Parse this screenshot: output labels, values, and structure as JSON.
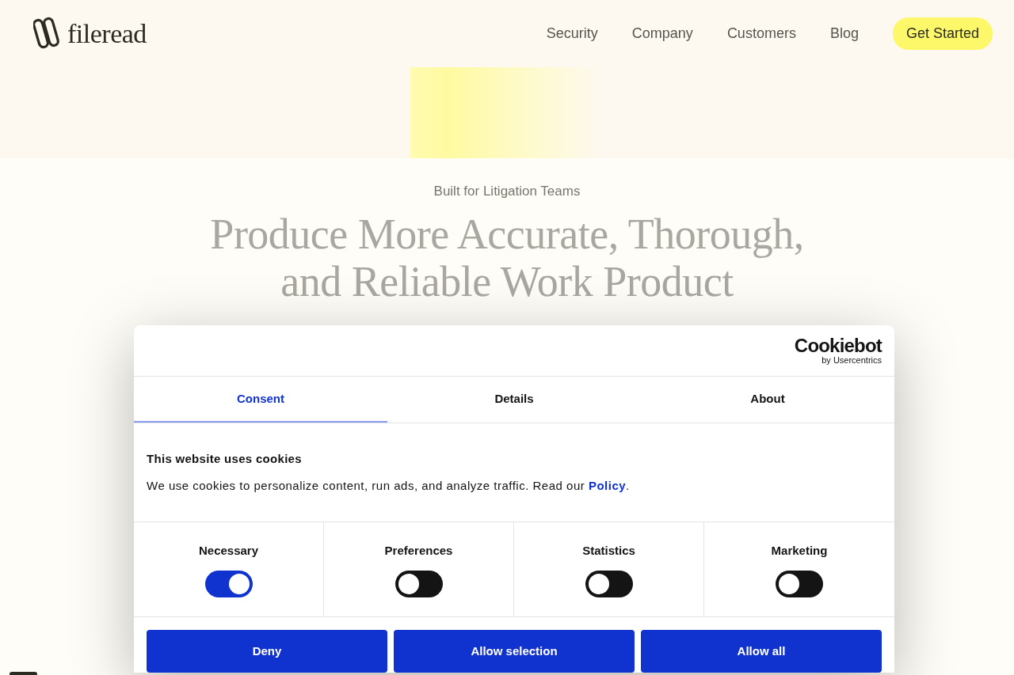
{
  "header": {
    "logo": {
      "text": "fileread"
    },
    "nav": [
      {
        "label": "Security"
      },
      {
        "label": "Company"
      },
      {
        "label": "Customers"
      },
      {
        "label": "Blog"
      }
    ],
    "cta": "Get Started"
  },
  "hero": {
    "eyebrow": "Built for Litigation Teams",
    "title_lines": [
      "Produce More Accurate, Thorough,",
      "and Reliable Work Product"
    ]
  },
  "cookie_dialog": {
    "brand": {
      "name": "Cookiebot",
      "byline": "by Usercentrics"
    },
    "tabs": [
      {
        "label": "Consent",
        "selected": true
      },
      {
        "label": "Details",
        "selected": false
      },
      {
        "label": "About",
        "selected": false
      }
    ],
    "heading": "This website uses cookies",
    "text": "We use cookies to personalize content, run ads, and analyze traffic. Read our",
    "link": "Policy",
    "text_after": ".",
    "categories": [
      {
        "label": "Necessary",
        "checked": true
      },
      {
        "label": "Preferences",
        "checked": false
      },
      {
        "label": "Statistics",
        "checked": false
      },
      {
        "label": "Marketing",
        "checked": false
      }
    ],
    "buttons": [
      "Deny",
      "Allow selection",
      "Allow all"
    ]
  }
}
